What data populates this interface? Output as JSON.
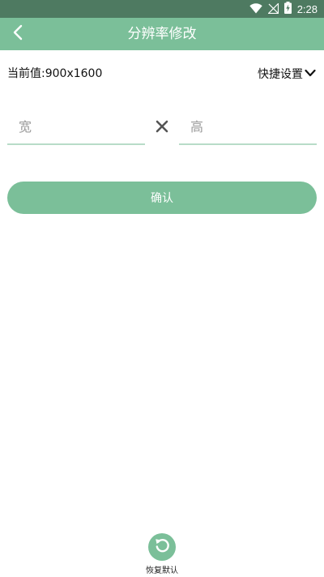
{
  "status_bar": {
    "time": "2:28",
    "icons": [
      "wifi-icon",
      "signal-icon",
      "battery-charging-icon"
    ],
    "color": "#4e7a61"
  },
  "app_bar": {
    "title": "分辨率修改",
    "back_icon": "chevron-left-icon",
    "color": "#7bbf99"
  },
  "resolution": {
    "current_label": "当前值:900x1600",
    "quick_settings_label": "快捷设置",
    "quick_settings_icon": "chevron-down-icon"
  },
  "inputs": {
    "width_placeholder": "宽",
    "width_value": "",
    "height_placeholder": "高",
    "height_value": "",
    "separator_icon": "times-icon"
  },
  "actions": {
    "confirm_label": "确认",
    "restore_label": "恢复默认",
    "restore_icon": "restore-icon",
    "accent_color": "#7bbf99"
  }
}
